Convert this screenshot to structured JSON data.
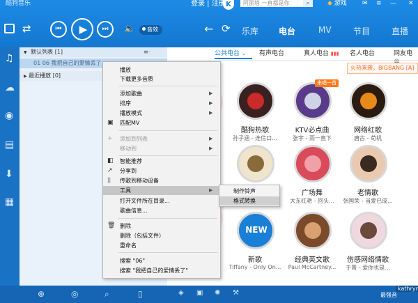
{
  "app": {
    "title": "酷狗音乐"
  },
  "header": {
    "login_text": "登录 | 注册",
    "logo_letter": "K",
    "search_placeholder": "阿丽塔 一直都是你",
    "search_icon": "search-icon",
    "game_label": "游戏",
    "nav_tabs": [
      {
        "label": "乐库",
        "active": false
      },
      {
        "label": "电台",
        "active": true
      },
      {
        "label": "MV",
        "active": false
      },
      {
        "label": "节目",
        "active": false
      },
      {
        "label": "直播",
        "active": false
      }
    ]
  },
  "player": {
    "quality_label": "音效",
    "prev_glyph": "⏮",
    "play_glyph": "▶",
    "next_glyph": "⏭"
  },
  "playlist": {
    "default_list": "默认列表",
    "default_count": "[1]",
    "song": "01  06  我把自己的爱情丢了",
    "recent_list": "最近播放",
    "recent_count": "[0]"
  },
  "radio_tabs": [
    {
      "label": "公共电台",
      "active": true
    },
    {
      "label": "有声电台",
      "active": false
    },
    {
      "label": "真人电台",
      "active": false
    },
    {
      "label": "名人电台",
      "active": false
    },
    {
      "label": "网友电台",
      "active": false
    }
  ],
  "promo": "火热来袭，BIGBANG [A]",
  "radios": [
    {
      "name": "酷狗热歌",
      "sub": "孙子涵 - 连信口...",
      "badge": ""
    },
    {
      "name": "KTV必点曲",
      "sub": "张宇 - 雨一直下",
      "badge": "来唱一首"
    },
    {
      "name": "网络红歌",
      "sub": "唐古 - 苟机",
      "badge": ""
    },
    {
      "name": "",
      "sub": "",
      "badge": ""
    },
    {
      "name": "广场舞",
      "sub": "大东红艳 - 回头...",
      "badge": ""
    },
    {
      "name": "老情歌",
      "sub": "张国荣 - 当爱已成...",
      "badge": ""
    },
    {
      "name": "新歌",
      "sub": "Tiffany - Only On...",
      "badge": ""
    },
    {
      "name": "经典英文歌",
      "sub": "Paul McCartney...",
      "badge": ""
    },
    {
      "name": "伤感网络情歌",
      "sub": "于菁 - 爱你也是...",
      "badge": ""
    }
  ],
  "context_menu": {
    "items": [
      {
        "label": "播放",
        "disabled": false,
        "arrow": false,
        "icon": ""
      },
      {
        "label": "下载更多音质",
        "disabled": false,
        "arrow": false,
        "icon": ""
      },
      {
        "label": "添加歌曲",
        "disabled": false,
        "arrow": true,
        "icon": ""
      },
      {
        "label": "排序",
        "disabled": false,
        "arrow": true,
        "icon": ""
      },
      {
        "label": "播放模式",
        "disabled": false,
        "arrow": true,
        "icon": ""
      },
      {
        "label": "匹配MV",
        "disabled": false,
        "arrow": false,
        "icon": "mv-icon"
      },
      {
        "label": "添加到列表",
        "disabled": true,
        "arrow": true,
        "icon": ""
      },
      {
        "label": "移动到",
        "disabled": true,
        "arrow": true,
        "icon": ""
      },
      {
        "label": "智能推荐",
        "disabled": false,
        "arrow": false,
        "icon": "recommend-icon"
      },
      {
        "label": "分享到",
        "disabled": false,
        "arrow": false,
        "icon": "share-icon"
      },
      {
        "label": "传歌到移动设备",
        "disabled": false,
        "arrow": false,
        "icon": "device-icon"
      },
      {
        "label": "工具",
        "disabled": false,
        "arrow": true,
        "icon": "",
        "highlighted": true
      },
      {
        "label": "打开文件所在目录...",
        "disabled": false,
        "arrow": false,
        "icon": ""
      },
      {
        "label": "歌曲信息...",
        "disabled": false,
        "arrow": false,
        "icon": ""
      },
      {
        "label": "删除",
        "disabled": false,
        "arrow": false,
        "icon": "delete-icon"
      },
      {
        "label": "删除（包括文件）",
        "disabled": false,
        "arrow": false,
        "icon": ""
      },
      {
        "label": "重命名",
        "disabled": false,
        "arrow": false,
        "icon": ""
      },
      {
        "label": "搜索 \"06\"",
        "disabled": false,
        "arrow": false,
        "icon": ""
      },
      {
        "label": "搜索 \"我把自己的爱情丢了\"",
        "disabled": false,
        "arrow": false,
        "icon": ""
      }
    ]
  },
  "tools_submenu": [
    {
      "label": "制作铃声",
      "highlighted": false
    },
    {
      "label": "格式转换",
      "highlighted": true
    }
  ],
  "bottom_bar": {
    "status": "最强音",
    "user": "kathryn"
  },
  "colors": {
    "brand": "#1a7fd6",
    "accent": "#ff7a1a",
    "menu_bg": "#f2f2f2"
  }
}
